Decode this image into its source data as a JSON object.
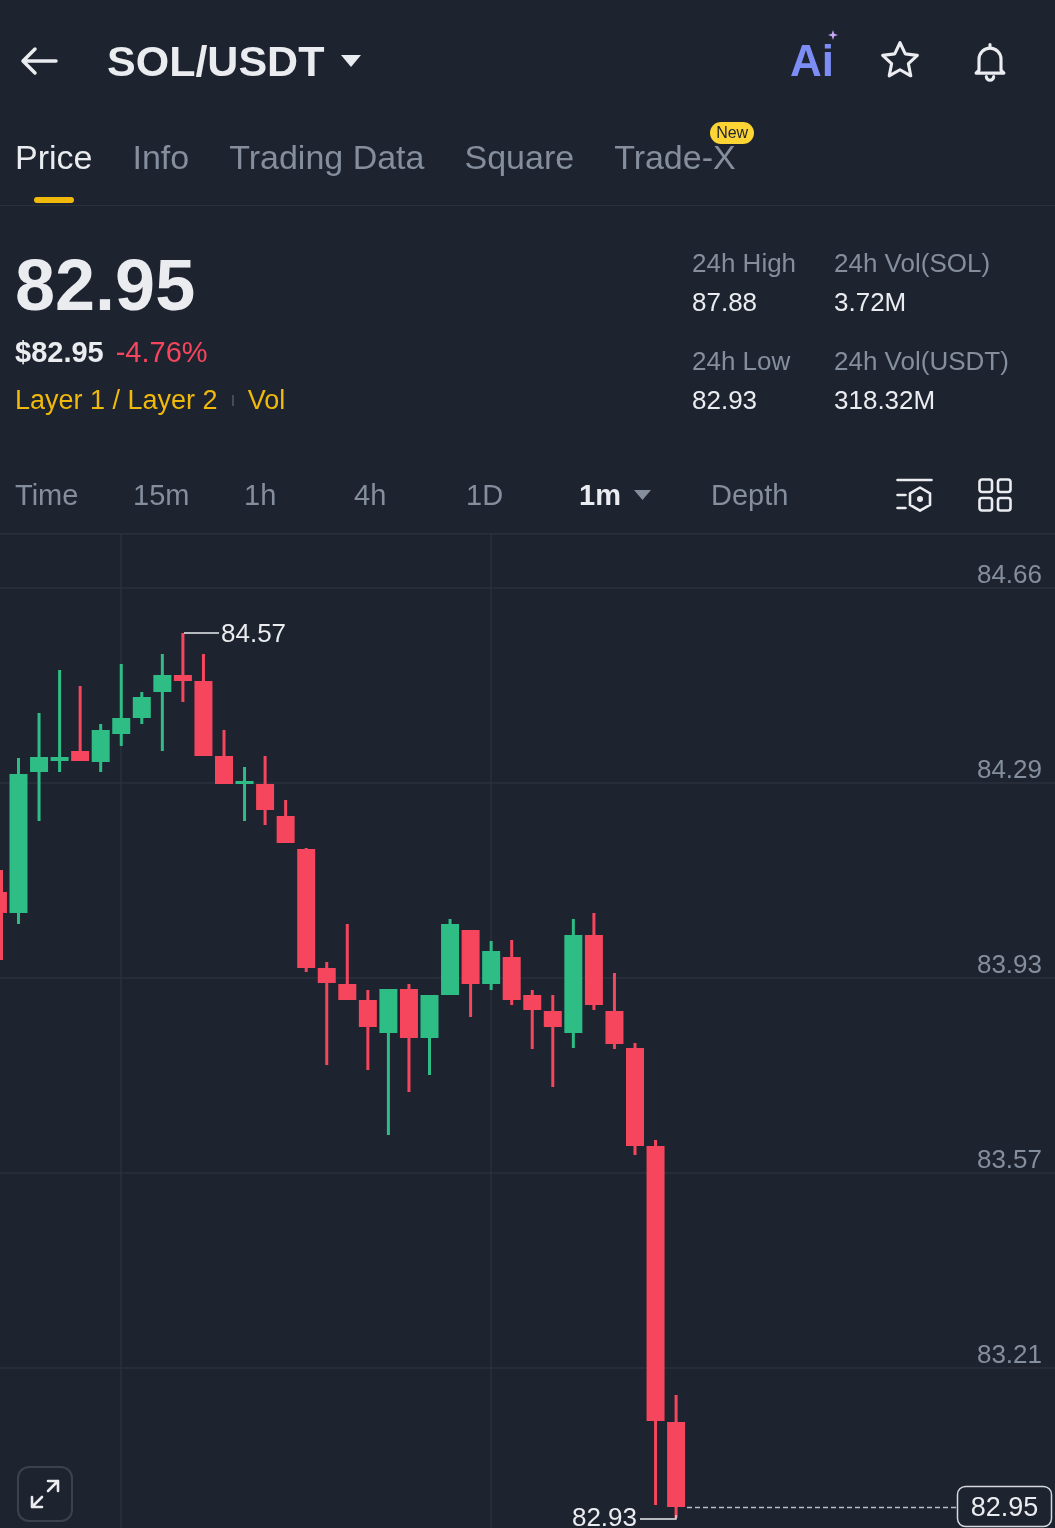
{
  "header": {
    "title": "SOL/USDT",
    "ai_label": "Ai"
  },
  "tabs": [
    {
      "label": "Price",
      "selected": true
    },
    {
      "label": "Info",
      "selected": false
    },
    {
      "label": "Trading Data",
      "selected": false
    },
    {
      "label": "Square",
      "selected": false
    },
    {
      "label": "Trade-X",
      "selected": false,
      "badge": "New"
    }
  ],
  "price": {
    "last": "82.95",
    "fiat": "$82.95",
    "change": "-4.76%",
    "tags": [
      "Layer 1 / Layer 2",
      "Vol"
    ]
  },
  "stats": [
    {
      "label": "24h High",
      "value": "87.88"
    },
    {
      "label": "24h Vol(SOL)",
      "value": "3.72M"
    },
    {
      "label": "24h Low",
      "value": "82.93"
    },
    {
      "label": "24h Vol(USDT)",
      "value": "318.32M"
    }
  ],
  "intervals": [
    {
      "label": "Time",
      "selected": false,
      "dropdown": false
    },
    {
      "label": "15m",
      "selected": false,
      "dropdown": false
    },
    {
      "label": "1h",
      "selected": false,
      "dropdown": false
    },
    {
      "label": "4h",
      "selected": false,
      "dropdown": false
    },
    {
      "label": "1D",
      "selected": false,
      "dropdown": false
    },
    {
      "label": "1m",
      "selected": true,
      "dropdown": true
    },
    {
      "label": "Depth",
      "selected": false,
      "dropdown": false
    }
  ],
  "chart": {
    "price_axis": [
      "84.66",
      "84.29",
      "83.93",
      "83.57",
      "83.21"
    ],
    "high_label": "84.57",
    "low_label": "82.93",
    "last_price": "82.95"
  }
}
